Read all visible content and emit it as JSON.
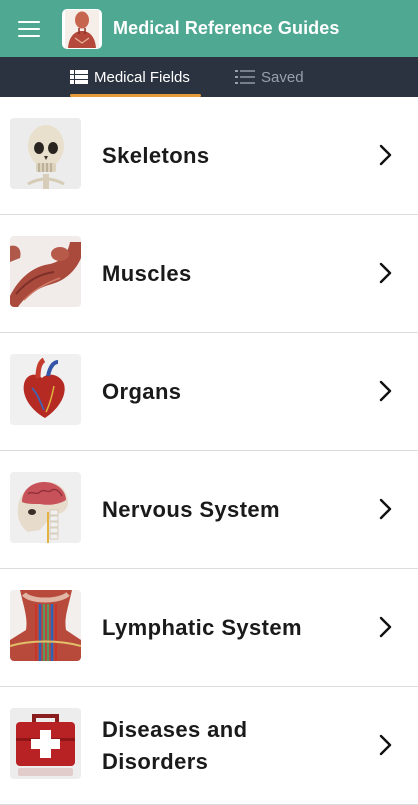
{
  "app_bar": {
    "title": "Medical Reference Guides",
    "menu_icon": "hamburger-menu-icon",
    "logo_icon": "anatomy-figure-logo"
  },
  "tabs": [
    {
      "label": "Medical Fields",
      "icon": "grid-list-icon",
      "active": true
    },
    {
      "label": "Saved",
      "icon": "list-icon",
      "active": false
    }
  ],
  "fields": [
    {
      "label": "Skeletons",
      "image": "skull-image"
    },
    {
      "label": "Muscles",
      "image": "arm-muscle-image"
    },
    {
      "label": "Organs",
      "image": "heart-image"
    },
    {
      "label": "Nervous System",
      "image": "brain-spine-image"
    },
    {
      "label": "Lymphatic System",
      "image": "neck-lymphatic-image"
    },
    {
      "label": "Diseases and Disorders",
      "image": "first-aid-kit-image"
    }
  ],
  "colors": {
    "app_bar": "#4fa892",
    "tab_bar": "#2b3340",
    "tab_indicator": "#e79a38",
    "tab_inactive": "#98a0ab"
  }
}
